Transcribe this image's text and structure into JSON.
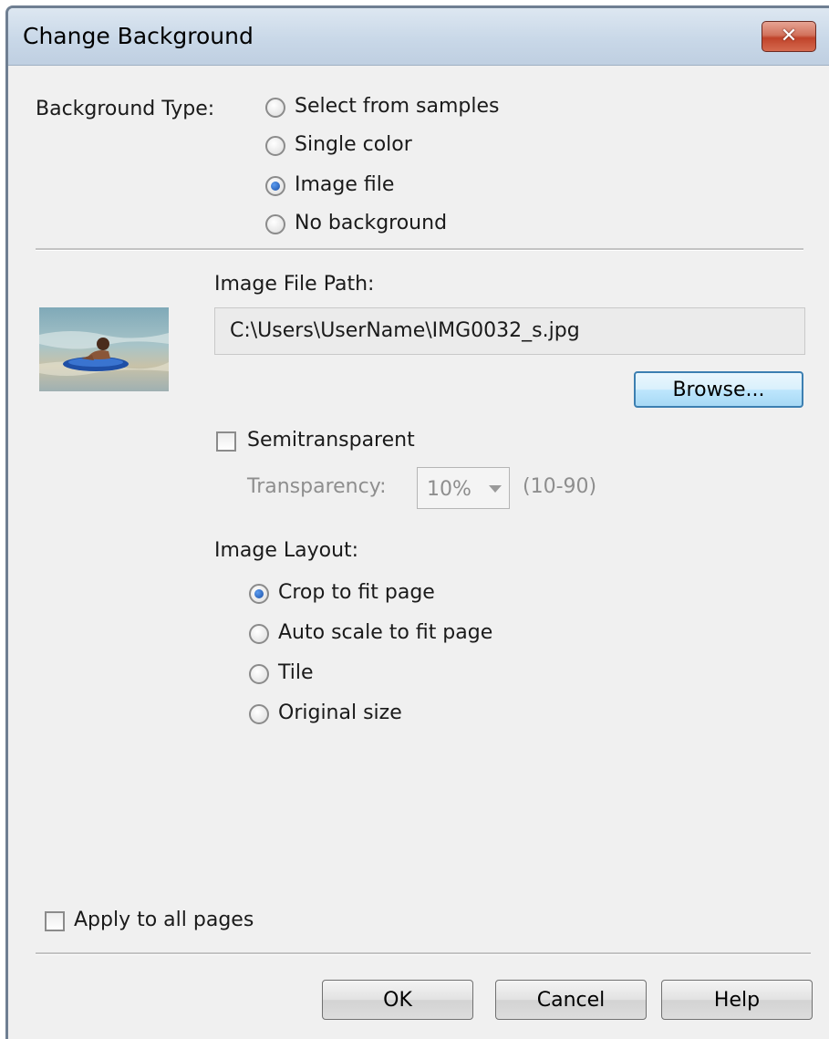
{
  "window": {
    "title": "Change Background",
    "close_label": "✕"
  },
  "background_type": {
    "label": "Background Type:",
    "options": [
      {
        "label": "Select from samples",
        "checked": false
      },
      {
        "label": "Single color",
        "checked": false
      },
      {
        "label": "Image file",
        "checked": true
      },
      {
        "label": "No background",
        "checked": false
      }
    ]
  },
  "image_file": {
    "path_label": "Image File Path:",
    "path_value": "C:\\Users\\UserName\\IMG0032_s.jpg",
    "browse_label": "Browse..."
  },
  "semitransparent": {
    "label": "Semitransparent",
    "checked": false,
    "transparency_label": "Transparency:",
    "transparency_value": "10%",
    "range_hint": "(10-90)"
  },
  "image_layout": {
    "label": "Image Layout:",
    "options": [
      {
        "label": "Crop to fit page",
        "checked": true
      },
      {
        "label": "Auto scale to fit page",
        "checked": false
      },
      {
        "label": "Tile",
        "checked": false
      },
      {
        "label": "Original size",
        "checked": false
      }
    ]
  },
  "apply_all": {
    "label": "Apply to all pages",
    "checked": false
  },
  "buttons": {
    "ok": "OK",
    "cancel": "Cancel",
    "help": "Help"
  }
}
